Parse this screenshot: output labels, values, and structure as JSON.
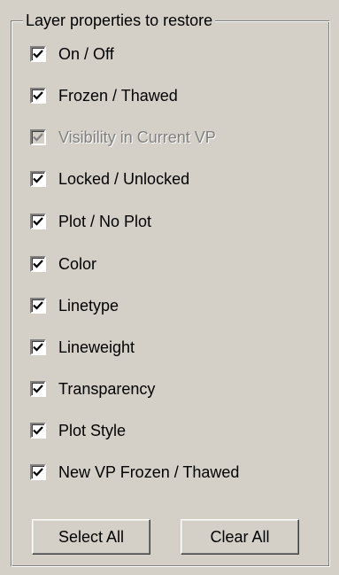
{
  "group": {
    "title": "Layer properties to restore"
  },
  "checkboxes": [
    {
      "label": "On / Off",
      "checked": true,
      "enabled": true
    },
    {
      "label": "Frozen / Thawed",
      "checked": true,
      "enabled": true
    },
    {
      "label": "Visibility in Current VP",
      "checked": true,
      "enabled": false
    },
    {
      "label": "Locked / Unlocked",
      "checked": true,
      "enabled": true
    },
    {
      "label": "Plot / No Plot",
      "checked": true,
      "enabled": true
    },
    {
      "label": "Color",
      "checked": true,
      "enabled": true
    },
    {
      "label": "Linetype",
      "checked": true,
      "enabled": true
    },
    {
      "label": "Lineweight",
      "checked": true,
      "enabled": true
    },
    {
      "label": "Transparency",
      "checked": true,
      "enabled": true
    },
    {
      "label": "Plot Style",
      "checked": true,
      "enabled": true
    },
    {
      "label": "New VP Frozen / Thawed",
      "checked": true,
      "enabled": true
    }
  ],
  "buttons": {
    "select_all": "Select All",
    "clear_all": "Clear All"
  },
  "icons": {
    "check": "check-mark-icon"
  },
  "colors": {
    "face": "#d4d0c8",
    "disabled_text": "#808080"
  }
}
